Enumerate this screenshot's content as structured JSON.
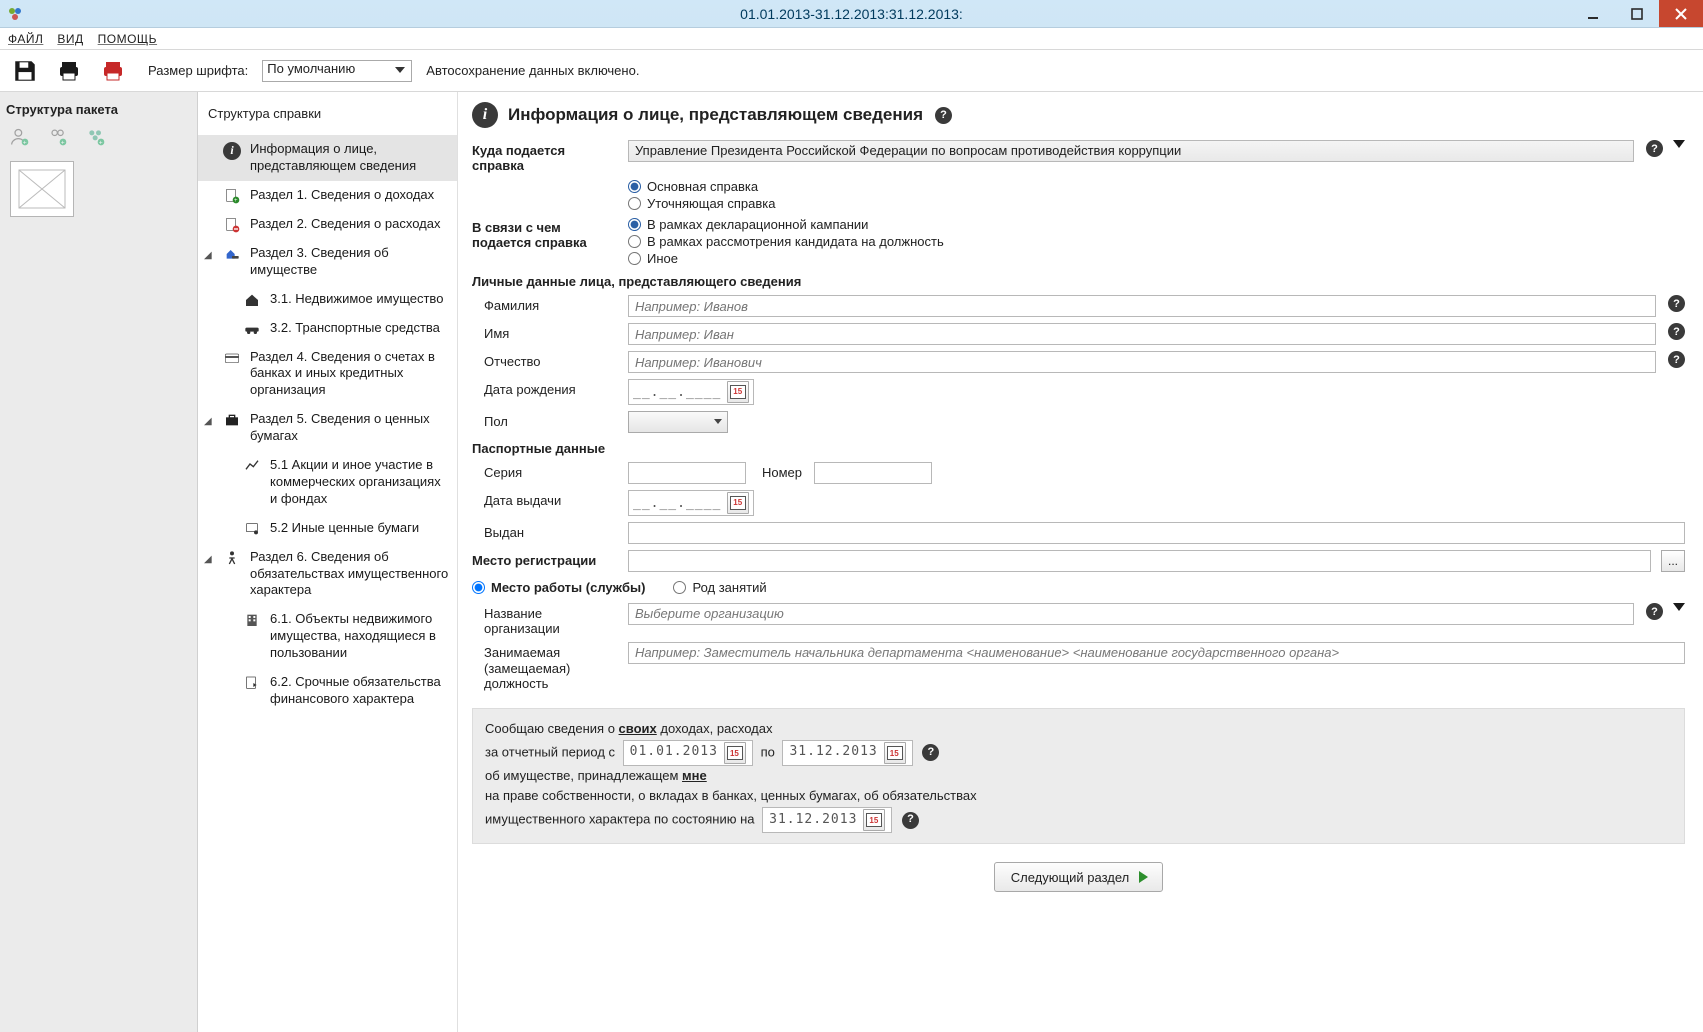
{
  "window": {
    "title": "01.01.2013-31.12.2013:31.12.2013:"
  },
  "menu": {
    "file": "ФАЙЛ",
    "view": "ВИД",
    "help": "ПОМОЩЬ"
  },
  "toolbar": {
    "font_label": "Размер шрифта:",
    "font_value": "По умолчанию",
    "autosave": "Автосохранение данных включено."
  },
  "left": {
    "title": "Структура пакета"
  },
  "nav": {
    "title": "Структура справки",
    "items": [
      "Информация о лице, представляющем сведения",
      "Раздел 1. Сведения о доходах",
      "Раздел 2. Сведения о расходах",
      "Раздел 3. Сведения об имуществе",
      "3.1. Недвижимое имущество",
      "3.2. Транспортные средства",
      "Раздел 4. Сведения о счетах в банках и иных кредитных организация",
      "Раздел 5. Сведения о ценных бумагах",
      "5.1 Акции и иное участие в коммерческих организациях и фондах",
      "5.2 Иные ценные бумаги",
      "Раздел 6. Сведения об обязательствах имущественного характера",
      "6.1. Объекты недвижимого имущества, находящиеся в пользовании",
      "6.2. Срочные обязательства финансового характера"
    ]
  },
  "content": {
    "heading": "Информация о лице, представляющем сведения",
    "where_label": "Куда подается справка",
    "where_value": "Управление Президента Российской Федерации по вопросам противодействия коррупции",
    "radio_type": {
      "main": "Основная справка",
      "clarify": "Уточняющая справка"
    },
    "reason_label": "В связи с чем подается справка",
    "radio_reason": {
      "campaign": "В рамках декларационной кампании",
      "candidate": "В рамках рассмотрения кандидата на должность",
      "other": "Иное"
    },
    "personal_heading": "Личные данные лица, представляющего сведения",
    "lastname_label": "Фамилия",
    "lastname_ph": "Например: Иванов",
    "firstname_label": "Имя",
    "firstname_ph": "Например: Иван",
    "middlename_label": "Отчество",
    "middlename_ph": "Например: Иванович",
    "dob_label": "Дата рождения",
    "date_mask": "__.__.____",
    "gender_label": "Пол",
    "passport_heading": "Паспортные данные",
    "series_label": "Серия",
    "number_label": "Номер",
    "issue_date_label": "Дата выдачи",
    "issued_by_label": "Выдан",
    "reg_label": "Место регистрации",
    "work_label": "Место работы (службы)",
    "occupation_label": "Род занятий",
    "org_label": "Название организации",
    "org_ph": "Выберите организацию",
    "position_label": "Занимаемая (замещаемая) должность",
    "position_ph": "Например: Заместитель начальника департамента <наименование> <наименование государственного органа>"
  },
  "summary": {
    "l1a": "Сообщаю сведения о ",
    "l1b": "своих",
    "l1c": " доходах, расходах",
    "l2a": "за отчетный период с",
    "date_from": "01.01.2013",
    "l2b": "по",
    "date_to": "31.12.2013",
    "l3a": "об имуществе, принадлежащем ",
    "l3b": "мне",
    "l4": "на праве собственности, о вкладах в банках, ценных бумагах, об обязательствах",
    "l5": "имущественного характера по состоянию на",
    "date_asof": "31.12.2013"
  },
  "next_button": "Следующий раздел"
}
